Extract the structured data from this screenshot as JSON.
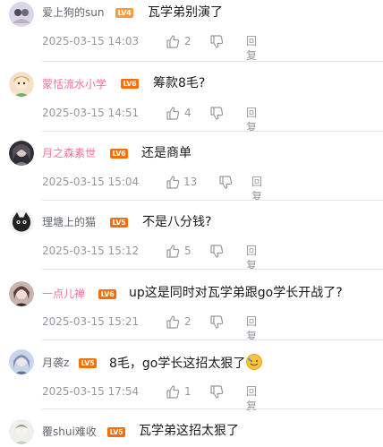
{
  "colors": {
    "level_badge": "#ff6c00",
    "vip_name": "#fb7299",
    "normal_name": "#61666d",
    "meta_text": "#9499a0"
  },
  "icons": [
    "thumbs-up-icon",
    "thumbs-down-icon",
    "emoji-icon"
  ],
  "comments": [
    {
      "user": "爱上狗的sun",
      "level": "LV4",
      "vip": false,
      "content": "瓦学弟别演了",
      "time": "2025-03-15 14:03",
      "likes": "2",
      "reply_label": "回复"
    },
    {
      "user": "蒙恬流水小学",
      "level": "LV6",
      "vip": true,
      "content": "筹款8毛?",
      "time": "2025-03-15 14:51",
      "likes": "4",
      "reply_label": "回复"
    },
    {
      "user": "月之森素世",
      "level": "LV6",
      "vip": true,
      "content": "还是商单",
      "time": "2025-03-15 15:04",
      "likes": "13",
      "reply_label": "回复"
    },
    {
      "user": "理塘上的猫",
      "level": "LV5",
      "vip": false,
      "content": "不是八分钱?",
      "time": "2025-03-15 15:12",
      "likes": "5",
      "reply_label": "回复"
    },
    {
      "user": "一点儿禅",
      "level": "LV6",
      "vip": true,
      "content": "up这是同时对瓦学弟跟go学长开战了?",
      "time": "2025-03-15 15:21",
      "likes": "2",
      "reply_label": "回复"
    },
    {
      "user": "月袭z",
      "level": "LV5",
      "vip": false,
      "content": "8毛，go学长这招太狠了",
      "time": "2025-03-15 17:54",
      "likes": "1",
      "reply_label": "回复"
    },
    {
      "user": "覆shui难收",
      "level": "LV5",
      "vip": false,
      "content": "瓦学弟这招太狠了"
    }
  ]
}
